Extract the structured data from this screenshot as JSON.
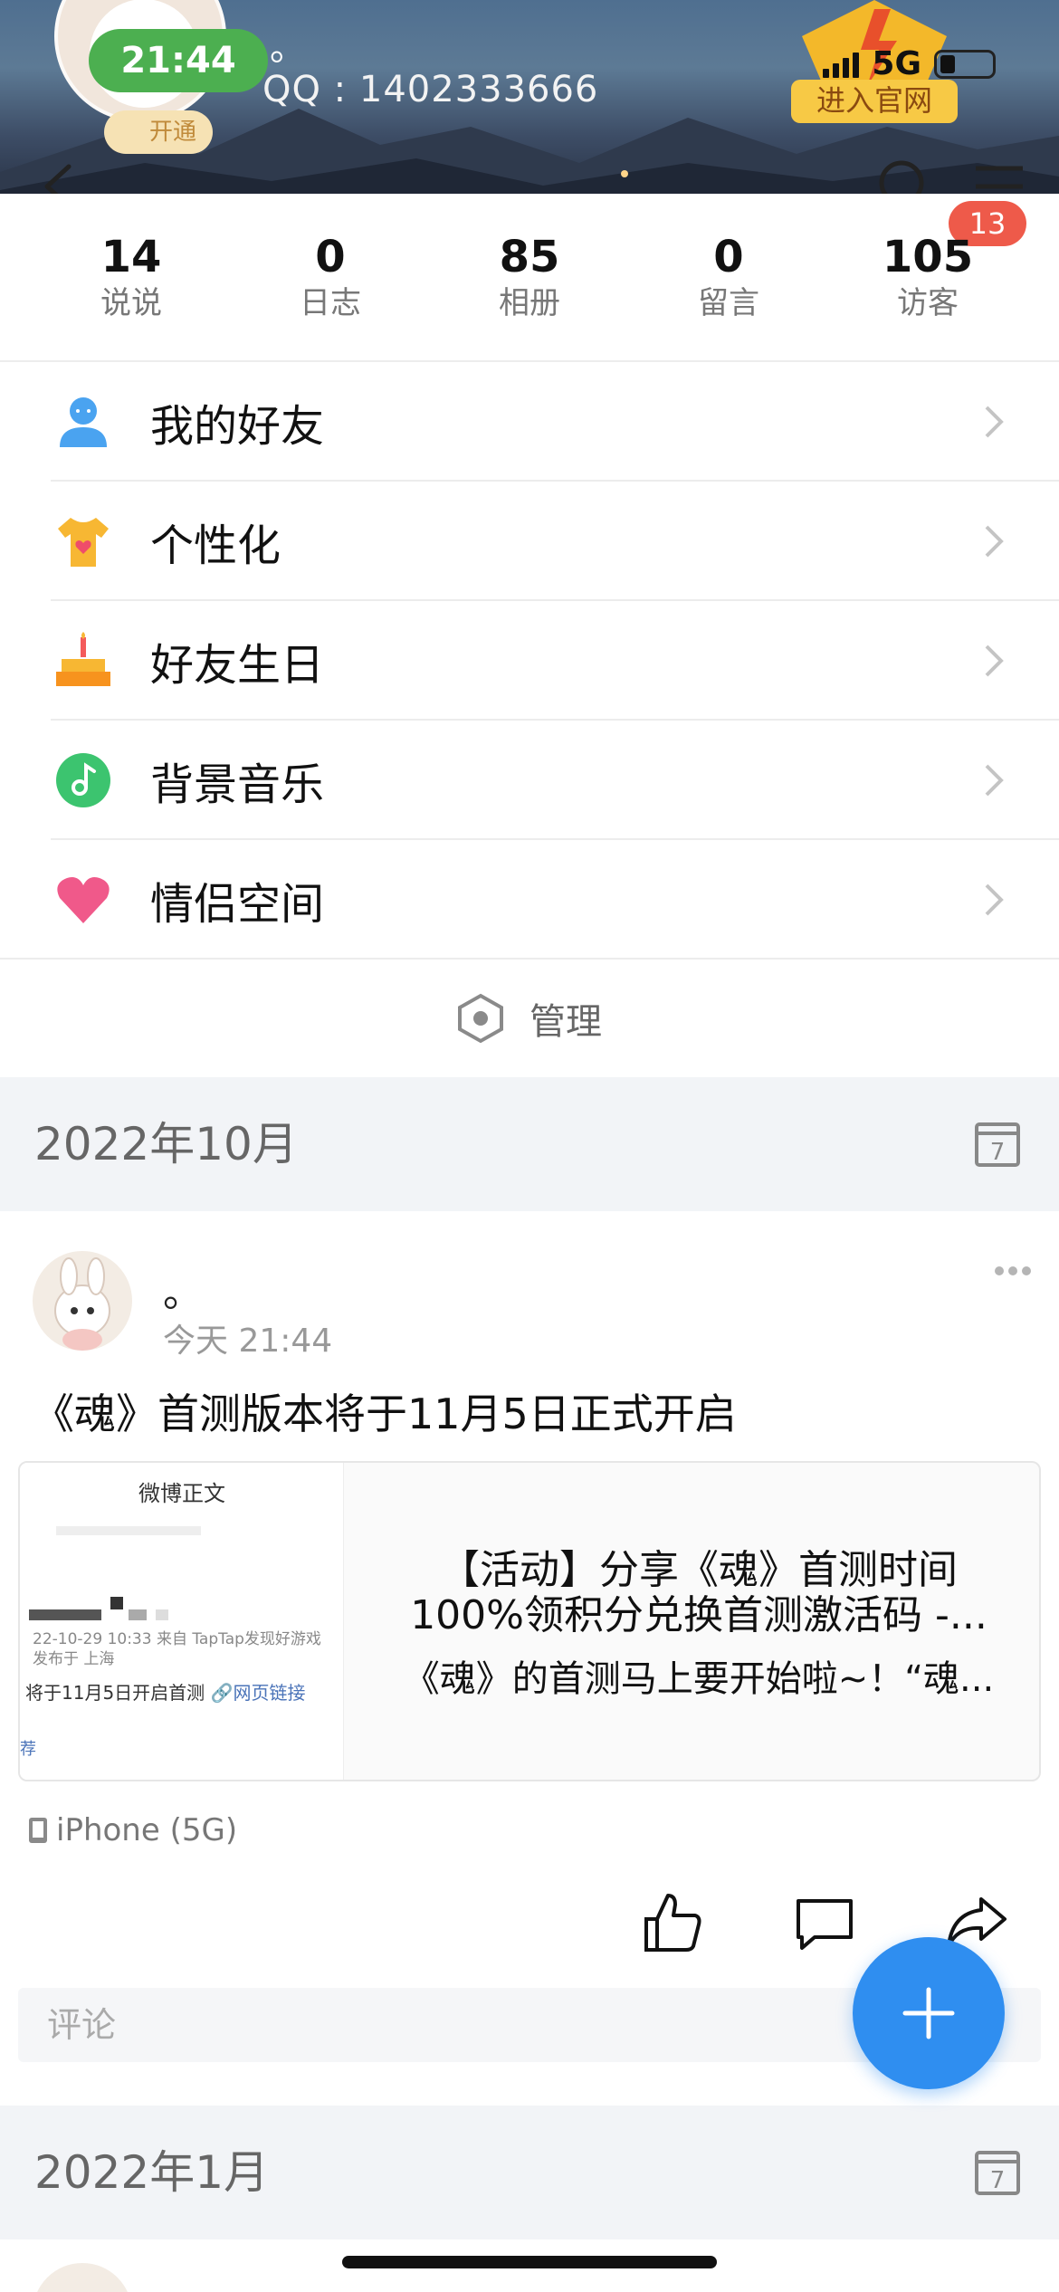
{
  "header": {
    "time": "21:44",
    "vip_label": "开通",
    "nickname": "。",
    "qq": "QQ : 1402333666",
    "network": "5G",
    "official_label": "进入官网",
    "notification_count": "13"
  },
  "stats": [
    {
      "value": "14",
      "label": "说说"
    },
    {
      "value": "0",
      "label": "日志"
    },
    {
      "value": "85",
      "label": "相册"
    },
    {
      "value": "0",
      "label": "留言"
    },
    {
      "value": "105",
      "label": "访客"
    }
  ],
  "menu": [
    {
      "label": "我的好友",
      "icon": "user-icon"
    },
    {
      "label": "个性化",
      "icon": "tshirt-icon"
    },
    {
      "label": "好友生日",
      "icon": "cake-icon"
    },
    {
      "label": "背景音乐",
      "icon": "music-icon"
    },
    {
      "label": "情侣空间",
      "icon": "heart-icon"
    }
  ],
  "manage_label": "管理",
  "month1": {
    "label": "2022年10月",
    "calendar_day": "7"
  },
  "post": {
    "author": "。",
    "time": "今天 21:44",
    "text": "《魂》首测版本将于11月5日正式开启",
    "share": {
      "thumb_title": "微博正文",
      "thumb_meta1": "22-10-29 10:33  来自 TapTap发现好游戏",
      "thumb_meta2": "发布于 上海",
      "thumb_line": "将于11月5日开启首测",
      "thumb_link": "网页链接",
      "thumb_rec": "荐",
      "title1": "【活动】分享《魂》首测时间",
      "title2": "100%领积分兑换首测激活码 -...",
      "desc": "《魂》的首测马上要开始啦~！“魂..."
    },
    "device": "iPhone (5G)",
    "comment_placeholder": "评论"
  },
  "month2": {
    "label": "2022年1月",
    "calendar_day": "7"
  },
  "colors": {
    "accent": "#2f8ef0",
    "badge": "#ee5a4a",
    "status_green": "#4caf50"
  }
}
